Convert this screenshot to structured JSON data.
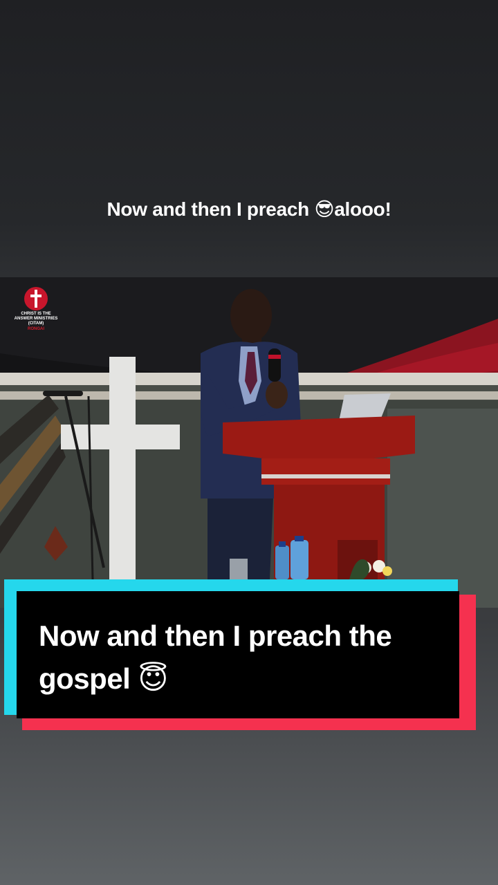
{
  "top_caption": "Now and then I preach 😎alooo!",
  "video": {
    "logo_lines": [
      "CHRIST IS THE",
      "ANSWER MINISTRIES",
      "(CITAM)"
    ],
    "logo_sub": "RONGAI"
  },
  "caption_box": {
    "text": "Now and then I preach the gospel 😇"
  },
  "colors": {
    "accent_cyan": "#25d7ec",
    "accent_red": "#f5314f",
    "pulpit": "#9b1a14"
  }
}
